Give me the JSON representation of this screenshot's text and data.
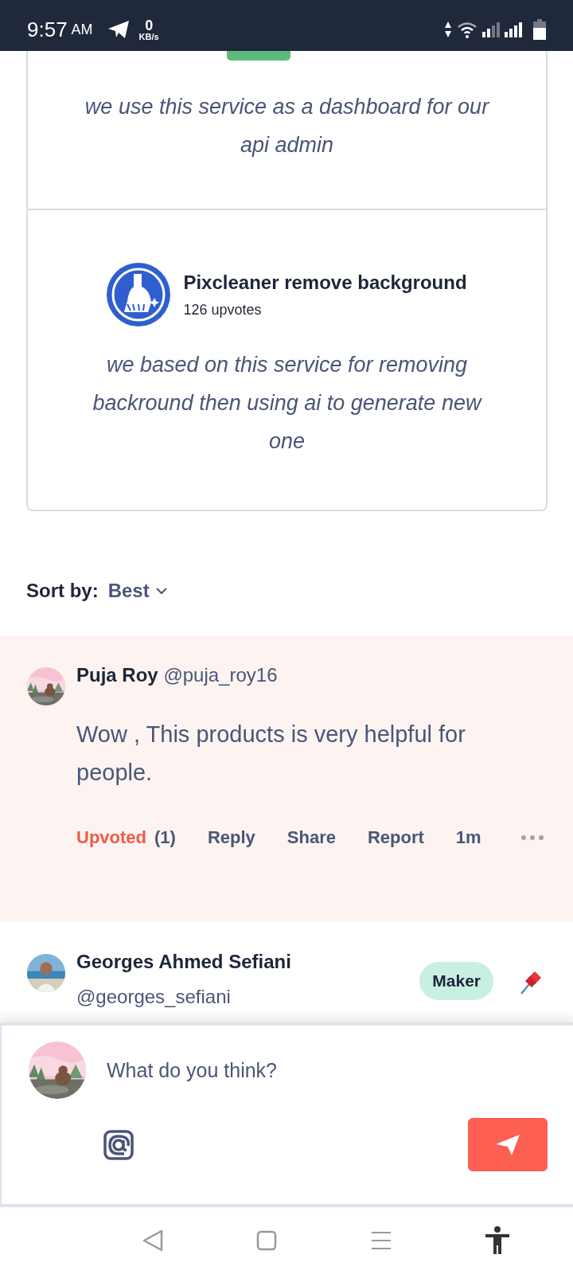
{
  "status_bar": {
    "time": "9:57",
    "ampm": "AM",
    "speed_value": "0",
    "speed_unit": "KB/s"
  },
  "product_cards": [
    {
      "kind": "partial",
      "quote": "we use this service as a dashboard for our api admin"
    },
    {
      "kind": "full",
      "name": "Pixcleaner remove background",
      "upvotes": "126 upvotes",
      "quote": "we based on this service for removing backround then using ai to generate new one"
    }
  ],
  "sort": {
    "label": "Sort by:",
    "value": "Best"
  },
  "comments": [
    {
      "author": "Puja Roy",
      "handle": "@puja_roy16",
      "highlighted": true,
      "text": "Wow , This products is very helpful for people.",
      "upvoted": true,
      "actions": {
        "upvote": "Upvoted",
        "count": "(1)",
        "reply": "Reply",
        "share": "Share",
        "report": "Report",
        "time": "1m"
      }
    },
    {
      "author": "Georges Ahmed Sefiani",
      "handle": "@georges_sefiani",
      "highlighted": false,
      "badge": "Maker",
      "pinned": true
    }
  ],
  "composer": {
    "placeholder": "What do you think?"
  }
}
